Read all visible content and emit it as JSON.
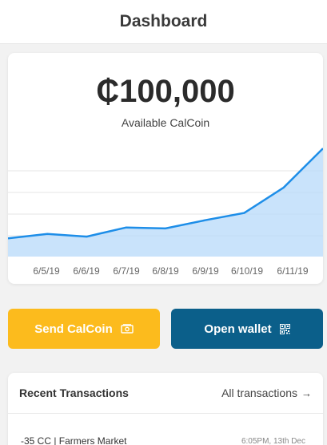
{
  "header": {
    "title": "Dashboard"
  },
  "balance": {
    "amount": "₵100,000",
    "label": "Available CalCoin"
  },
  "chart_data": {
    "type": "area",
    "x": [
      "6/5/19",
      "6/6/19",
      "6/7/19",
      "6/8/19",
      "6/9/19",
      "6/10/19",
      "6/11/19"
    ],
    "series": [
      {
        "values": [
          10,
          10.5,
          10.2,
          11.2,
          11.1,
          12,
          12.8,
          15.6,
          19.9
        ]
      }
    ],
    "colors": {
      "line": "#1e8ee8",
      "fill": "#bcdcfa"
    },
    "grid": true
  },
  "actions": {
    "send_label": "Send CalCoin",
    "send_icon": "cash-icon",
    "wallet_label": "Open wallet",
    "wallet_icon": "qr-code-icon"
  },
  "transactions": {
    "title": "Recent Transactions",
    "all_label": "All transactions",
    "items": [
      {
        "desc": "-35 CC  |  Farmers Market",
        "time": "6:05PM, 13th Dec"
      }
    ]
  }
}
